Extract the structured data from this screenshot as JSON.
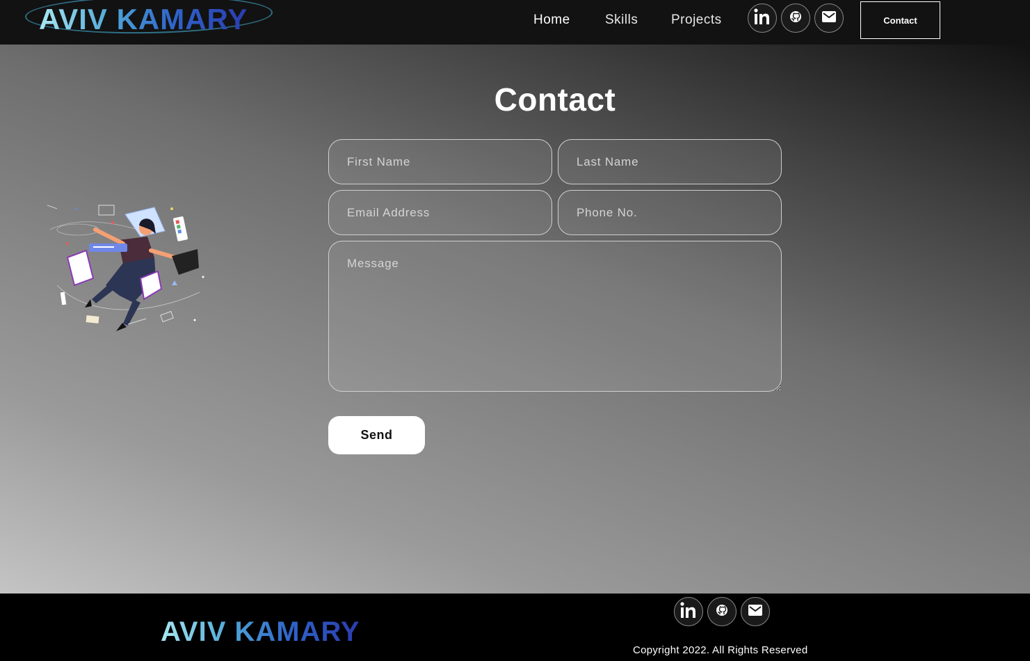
{
  "brand": {
    "name": "AVIV KAMARY",
    "gradient": [
      "#a8e8f2",
      "#4fa6d8",
      "#2f63c9",
      "#2a3cae"
    ]
  },
  "nav": {
    "links": [
      {
        "label": "Home"
      },
      {
        "label": "Skills"
      },
      {
        "label": "Projects"
      }
    ],
    "social_icons": [
      "linkedin-icon",
      "github-icon",
      "mail-icon"
    ],
    "contact_label": "Contact"
  },
  "contact": {
    "title": "Contact",
    "first_name_placeholder": "First Name",
    "last_name_placeholder": "Last Name",
    "email_placeholder": "Email Address",
    "phone_placeholder": "Phone No.",
    "message_placeholder": "Message",
    "send_label": "Send"
  },
  "footer": {
    "logo": "AVIV KAMARY",
    "social_icons": [
      "linkedin-icon",
      "github-icon",
      "mail-icon"
    ],
    "copyright": "Copyright 2022. All Rights Reserved"
  },
  "colors": {
    "navbar_bg": "#121212",
    "footer_bg": "#000000",
    "button_bg": "#ffffff"
  }
}
